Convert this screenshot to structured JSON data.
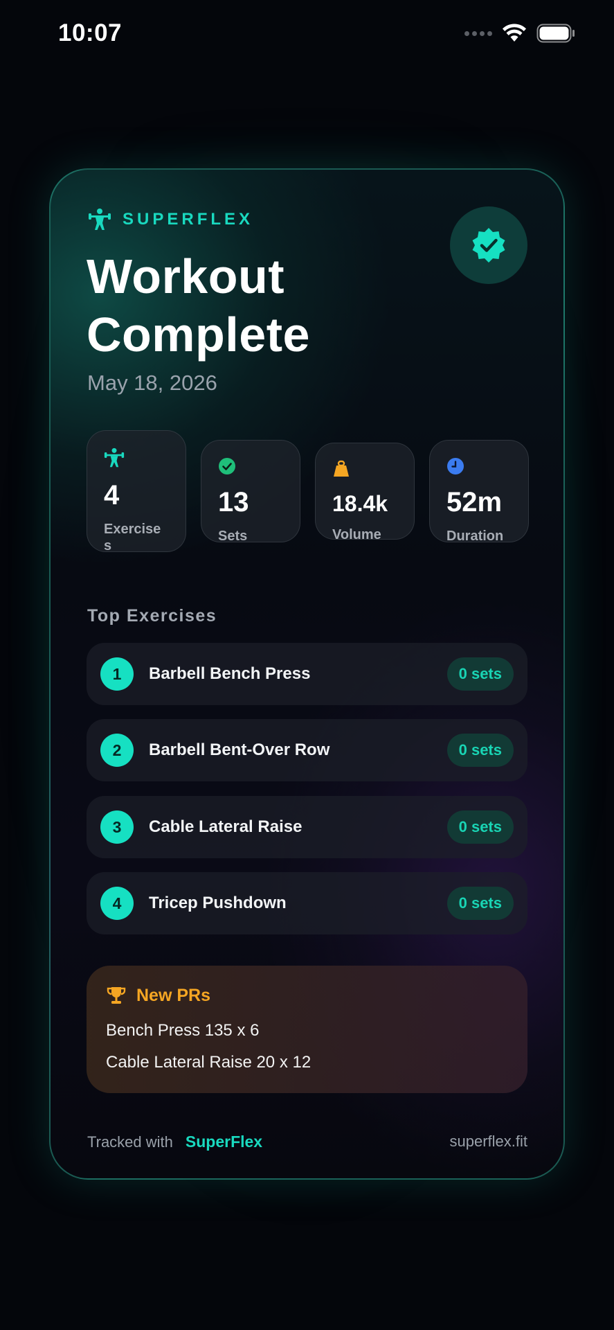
{
  "status_bar": {
    "time": "10:07"
  },
  "card": {
    "brand": "SUPERFLEX",
    "title_line1": "Workout",
    "title_line2": "Complete",
    "date": "May 18, 2026",
    "stats": [
      {
        "value": "4",
        "label": "Exercise s",
        "icon": "weightlifter-icon",
        "color": "#19d9bf"
      },
      {
        "value": "13",
        "label": "Sets",
        "icon": "check-circle-icon",
        "color": "#1fbf7a"
      },
      {
        "value": "18.4k",
        "label": "Volume",
        "icon": "weight-icon",
        "color": "#f5a623"
      },
      {
        "value": "52m",
        "label": "Duration",
        "icon": "clock-icon",
        "color": "#3b7cf0"
      }
    ],
    "section_title": "Top Exercises",
    "exercises": [
      {
        "num": "1",
        "name": "Barbell Bench Press",
        "sets": "0 sets"
      },
      {
        "num": "2",
        "name": "Barbell Bent-Over Row",
        "sets": "0 sets"
      },
      {
        "num": "3",
        "name": "Cable Lateral Raise",
        "sets": "0 sets"
      },
      {
        "num": "4",
        "name": "Tricep Pushdown",
        "sets": "0 sets"
      }
    ],
    "prs": {
      "title": "New PRs",
      "items": [
        "Bench Press 135 x 6",
        "Cable Lateral Raise 20 x 12"
      ]
    },
    "footer": {
      "tracked_with": "Tracked with",
      "brand": "SuperFlex",
      "site": "superflex.fit"
    }
  },
  "colors": {
    "accent": "#19d9bf",
    "pr_gold": "#f5a623",
    "background": "#04060b"
  }
}
